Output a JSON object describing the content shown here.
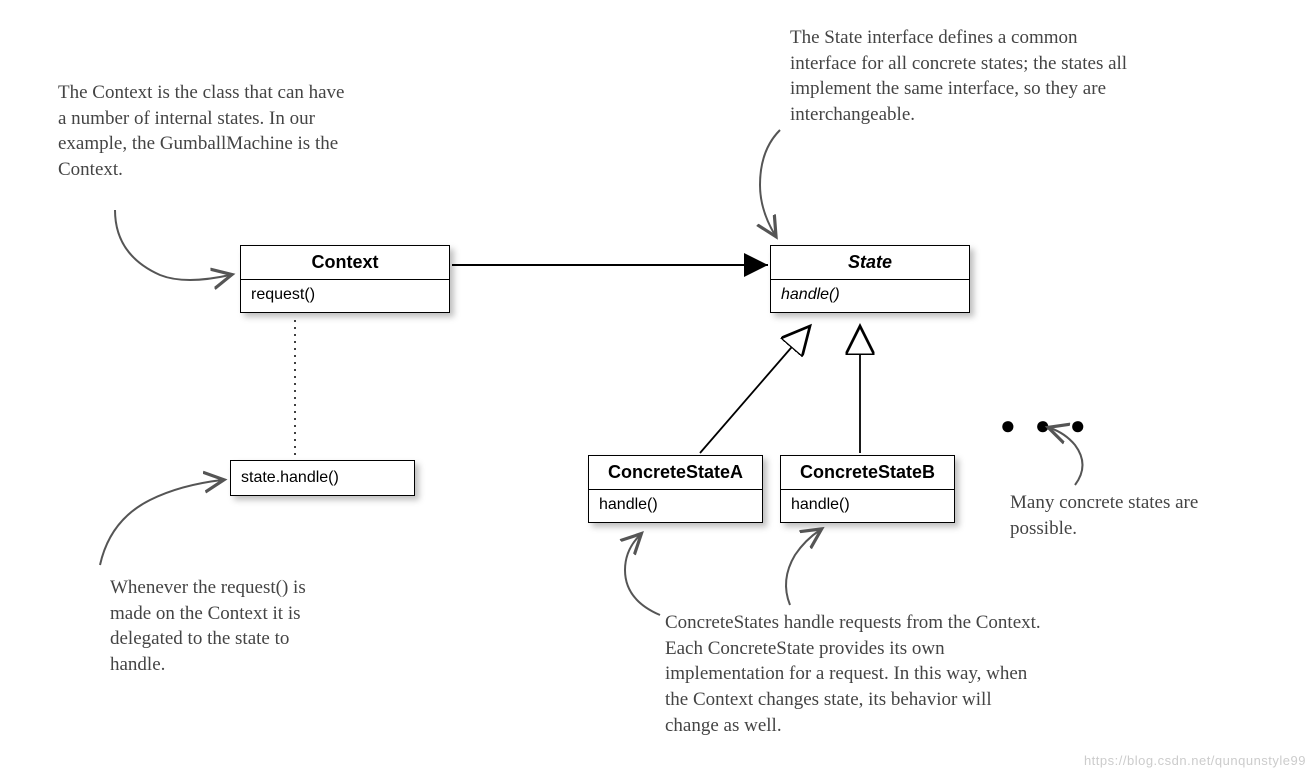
{
  "annotations": {
    "context_note": "The Context is the class that can have a number of internal states.  In our example, the GumballMachine is the Context.",
    "state_note": "The State interface defines a common interface for all concrete states;  the states all implement the same interface, so they are interchangeable.",
    "request_note": "Whenever the request() is made on the Context it is delegated to the state to handle.",
    "concrete_note": "ConcreteStates handle requests from the Context. Each ConcreteState provides its own implementation for a request.  In this way, when the Context changes state, its behavior will change as well.",
    "many_note": "Many concrete states are possible."
  },
  "classes": {
    "context": {
      "name": "Context",
      "method": "request()"
    },
    "state": {
      "name": "State",
      "method": "handle()"
    },
    "concreteA": {
      "name": "ConcreteStateA",
      "method": "handle()"
    },
    "concreteB": {
      "name": "ConcreteStateB",
      "method": "handle()"
    }
  },
  "note_box": {
    "text": "state.handle()"
  },
  "ellipsis": "● ● ●",
  "watermark": "https://blog.csdn.net/qunqunstyle99"
}
